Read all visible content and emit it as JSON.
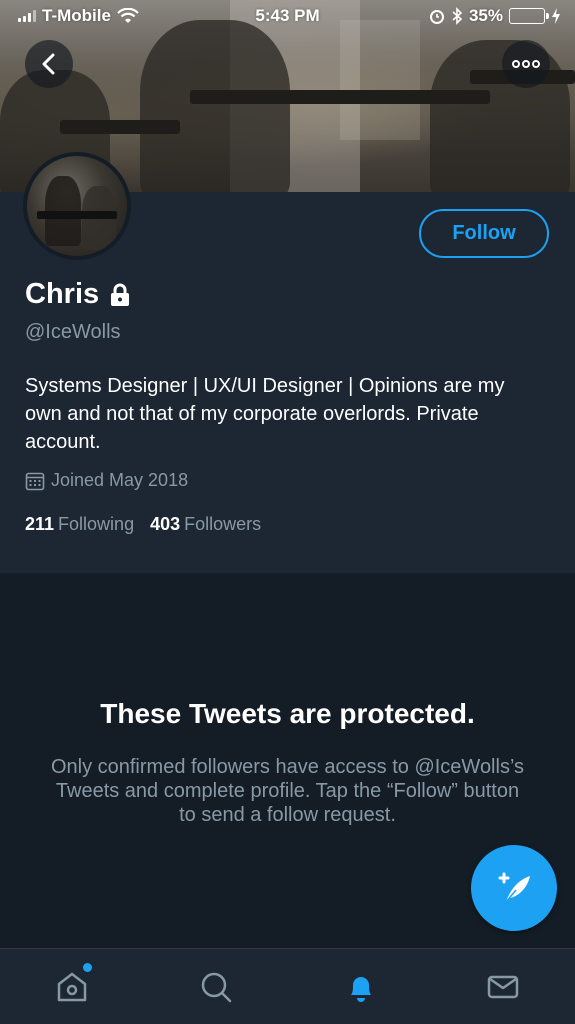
{
  "status_bar": {
    "carrier": "T-Mobile",
    "time": "5:43 PM",
    "battery_percent": "35%",
    "battery_level": 0.35
  },
  "profile": {
    "name": "Chris",
    "handle": "@IceWolls",
    "bio": "Systems Designer | UX/UI Designer | Opinions are my own and not that of my corporate overlords. Private account.",
    "joined": "Joined May 2018",
    "following_count": "211",
    "following_label": "Following",
    "followers_count": "403",
    "followers_label": "Followers",
    "follow_button": "Follow"
  },
  "protected": {
    "title": "These Tweets are protected.",
    "description": "Only confirmed followers have access to @IceWolls’s Tweets and complete profile. Tap the “Follow” button to send a follow request."
  },
  "tabs": [
    {
      "name": "home",
      "icon": "home-icon",
      "active": false,
      "has_dot": true
    },
    {
      "name": "search",
      "icon": "search-icon",
      "active": false
    },
    {
      "name": "notifications",
      "icon": "bell-icon",
      "active": true
    },
    {
      "name": "messages",
      "icon": "mail-icon",
      "active": false
    }
  ],
  "colors": {
    "accent": "#1da1f2",
    "background": "#141d26",
    "panel": "#1c2733",
    "secondary_text": "#8899a6"
  }
}
